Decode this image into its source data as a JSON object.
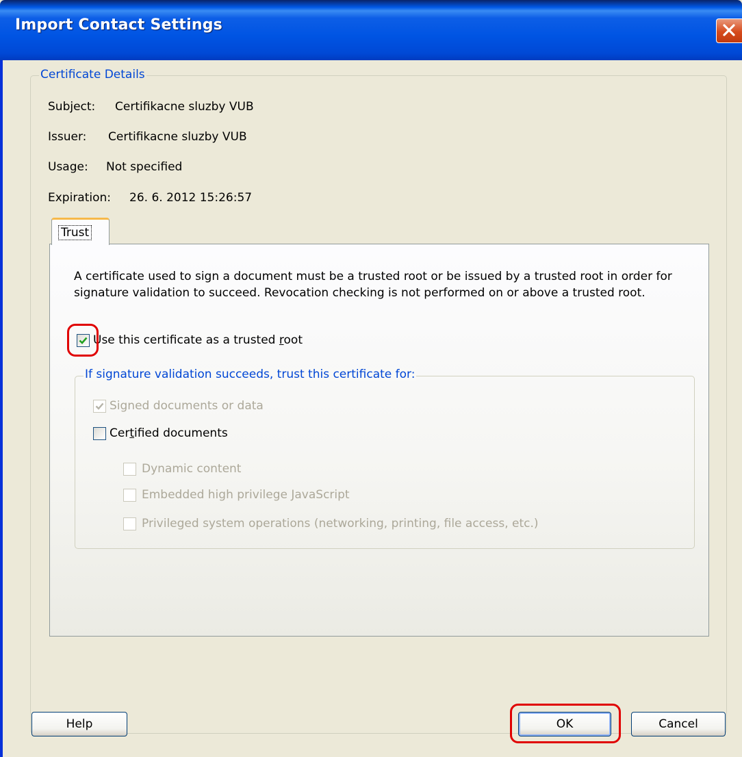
{
  "window": {
    "title": "Import Contact Settings"
  },
  "certificate_details": {
    "legend": "Certificate Details",
    "subject_label": "Subject:",
    "subject_value": "Certifikacne sluzby VUB",
    "issuer_label": "Issuer:",
    "issuer_value": "Certifikacne sluzby VUB",
    "usage_label": "Usage:",
    "usage_value": "Not specified",
    "expiration_label": "Expiration:",
    "expiration_value": "26. 6. 2012 15:26:57"
  },
  "tabs": [
    {
      "label": "Trust",
      "selected": true
    }
  ],
  "trust": {
    "description": "A certificate used to sign a document must be a trusted root or be issued by a trusted root in order for signature validation to succeed.  Revocation checking is not performed on or above a trusted root.",
    "trusted_root": {
      "label_pre": "Use this certificate as a trusted ",
      "label_u": "r",
      "label_post": "oot",
      "checked": true
    },
    "validation_group": {
      "legend": "If signature validation succeeds, trust this certificate for:",
      "signed_docs": {
        "label": "Signed documents or data",
        "checked": true,
        "enabled": false
      },
      "certified_docs": {
        "label_pre": "Cer",
        "label_u": "t",
        "label_post": "ified documents",
        "checked": false,
        "enabled": true
      },
      "dynamic_content": {
        "label": "Dynamic content",
        "checked": false,
        "enabled": false
      },
      "embedded_js": {
        "label": "Embedded high privilege JavaScript",
        "checked": false,
        "enabled": false
      },
      "privileged_ops": {
        "label": "Privileged system operations (networking, printing, file access, etc.)",
        "checked": false,
        "enabled": false
      }
    }
  },
  "buttons": {
    "help": "Help",
    "ok": "OK",
    "cancel": "Cancel"
  },
  "colors": {
    "highlight_ring": "#e00000",
    "legend_text": "#0046d5",
    "tab_accent": "#f7b94a"
  },
  "icons": {
    "close": "close-icon",
    "checkmark": "checkmark-icon"
  }
}
